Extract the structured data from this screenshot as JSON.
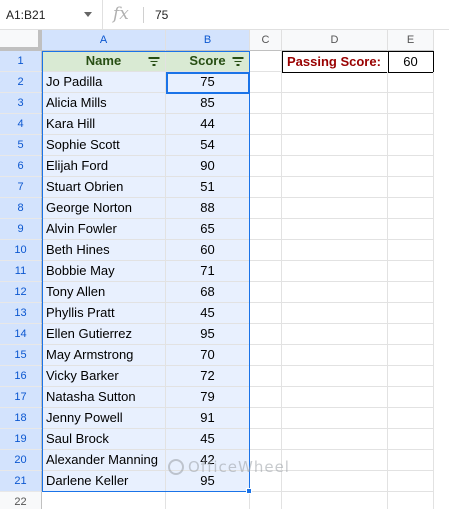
{
  "formula_bar": {
    "name_box": "A1:B21",
    "fx_label": "fx",
    "formula_value": "75"
  },
  "columns": [
    "A",
    "B",
    "C",
    "D",
    "E"
  ],
  "rows": [
    "1",
    "2",
    "3",
    "4",
    "5",
    "6",
    "7",
    "8",
    "9",
    "10",
    "11",
    "12",
    "13",
    "14",
    "15",
    "16",
    "17",
    "18",
    "19",
    "20",
    "21",
    "22"
  ],
  "table": {
    "header_name": "Name",
    "header_score": "Score",
    "records": [
      {
        "name": "Jo Padilla",
        "score": "75"
      },
      {
        "name": "Alicia Mills",
        "score": "85"
      },
      {
        "name": "Kara Hill",
        "score": "44"
      },
      {
        "name": "Sophie Scott",
        "score": "54"
      },
      {
        "name": "Elijah Ford",
        "score": "90"
      },
      {
        "name": "Stuart Obrien",
        "score": "51"
      },
      {
        "name": "George Norton",
        "score": "88"
      },
      {
        "name": "Alvin Fowler",
        "score": "65"
      },
      {
        "name": "Beth Hines",
        "score": "60"
      },
      {
        "name": "Bobbie May",
        "score": "71"
      },
      {
        "name": "Tony Allen",
        "score": "68"
      },
      {
        "name": "Phyllis Pratt",
        "score": "45"
      },
      {
        "name": "Ellen Gutierrez",
        "score": "95"
      },
      {
        "name": "May Armstrong",
        "score": "70"
      },
      {
        "name": "Vicky Barker",
        "score": "72"
      },
      {
        "name": "Natasha Sutton",
        "score": "79"
      },
      {
        "name": "Jenny Powell",
        "score": "91"
      },
      {
        "name": "Saul Brock",
        "score": "45"
      },
      {
        "name": "Alexander Manning",
        "score": "42"
      },
      {
        "name": "Darlene Keller",
        "score": "95"
      }
    ]
  },
  "passing": {
    "label": "Passing Score:",
    "value": "60"
  },
  "watermark": "OfficeWheel",
  "colors": {
    "header_fill": "#d9ead3",
    "body_fill": "#e8f0fe",
    "selection": "#1a73e8",
    "label_text": "#990000"
  }
}
